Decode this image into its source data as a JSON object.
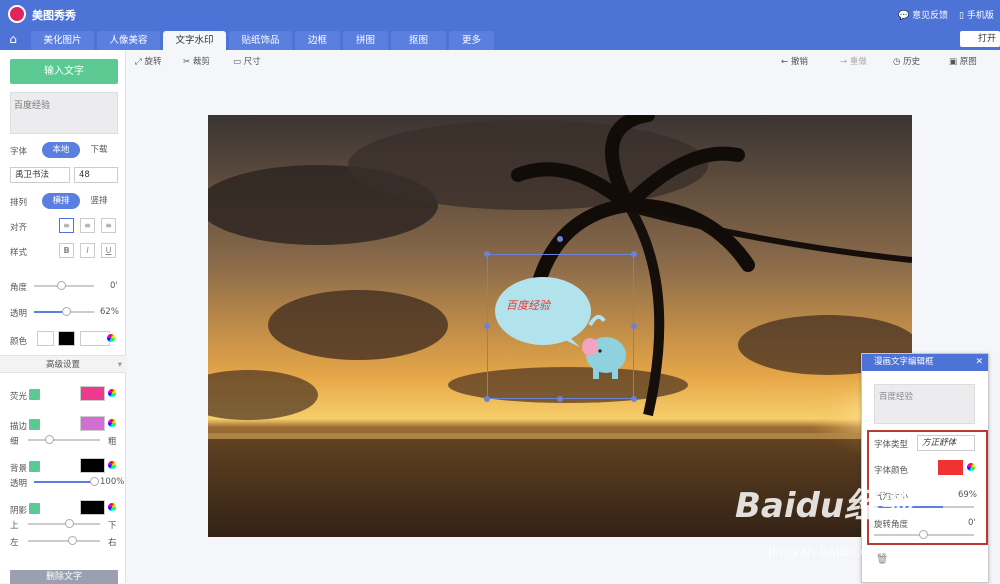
{
  "app": {
    "name": "美图秀秀"
  },
  "titlebar": {
    "feedback": "意见反馈",
    "mobile": "手机版"
  },
  "tabs": [
    "美化图片",
    "人像美容",
    "文字水印",
    "贴纸饰品",
    "边框",
    "拼图",
    "抠图",
    "更多"
  ],
  "open_button": "打开",
  "toolbar": {
    "rotate": "旋转",
    "crop": "裁剪",
    "size": "尺寸",
    "undo": "撤销",
    "redo": "重做",
    "history": "历史",
    "original": "原图"
  },
  "left": {
    "add_text": "输入文字",
    "text_content": "百度经验",
    "font_label": "字体",
    "font_local": "本地",
    "font_download": "下载",
    "font_name": "禹卫书法",
    "font_size": "48",
    "layout_label": "排列",
    "layout_h": "横排",
    "layout_v": "竖排",
    "align_label": "对齐",
    "style_label": "样式",
    "style_b": "B",
    "style_i": "I",
    "style_u": "U",
    "angle_label": "角度",
    "angle_value": "0'",
    "opacity_label": "透明",
    "opacity_value": "62%",
    "color_label": "颜色",
    "advanced": "高级设置",
    "glow_label": "荧光",
    "stroke_label": "描边",
    "thin": "细",
    "thick": "粗",
    "bg_label": "背景",
    "bg_opacity_label": "透明",
    "bg_opacity_value": "100%",
    "shadow_label": "阴影",
    "up": "上",
    "down": "下",
    "left_l": "左",
    "right_r": "右",
    "delete": "删除文字"
  },
  "colors": {
    "glow": "#ee3a8c",
    "stroke": "#d36fd3",
    "accent": "#4e73d6",
    "green": "#5bc992",
    "bubble_font": "#ee3333"
  },
  "bubble": {
    "text": "百度经验"
  },
  "dialog": {
    "title": "漫画文字编辑框",
    "close": "✕",
    "text": "百度经验",
    "font_type_label": "字体类型",
    "font_type_value": "方正舒体",
    "font_color_label": "字体颜色",
    "bubble_size_label": "气泡大小",
    "bubble_size_value": "69%",
    "rotate_label": "旋转角度",
    "rotate_value": "0'"
  },
  "watermark": {
    "main": "Baidu经验",
    "url": "jingyan.baidu.com"
  }
}
